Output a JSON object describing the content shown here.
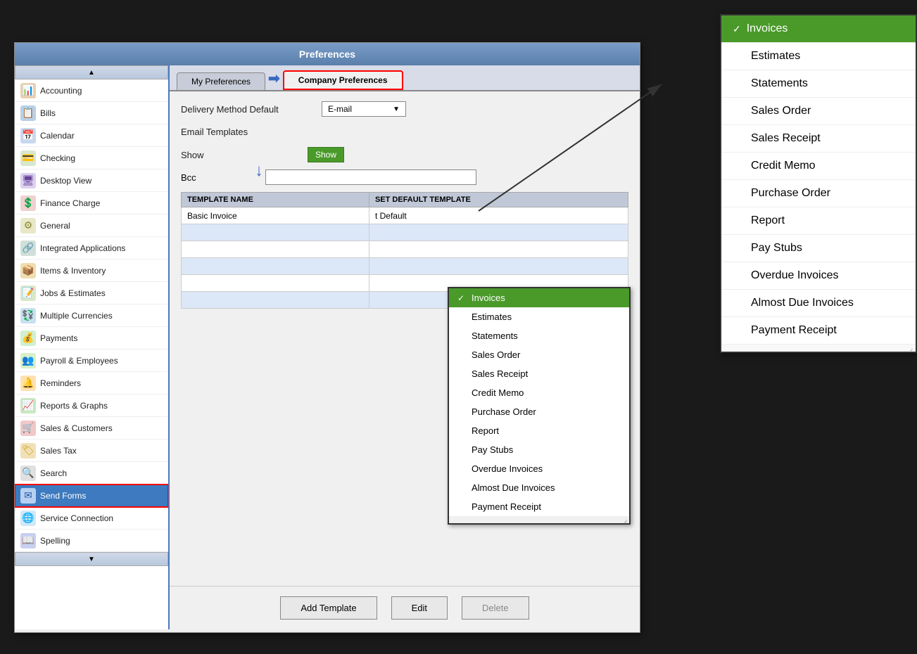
{
  "window": {
    "title": "Preferences"
  },
  "tabs": {
    "my_preferences": "My Preferences",
    "company_preferences": "Company Preferences"
  },
  "fields": {
    "delivery_method_label": "Delivery Method Default",
    "delivery_method_value": "E-mail",
    "email_templates_label": "Email Templates",
    "show_label": "Show",
    "bcc_label": "Bcc"
  },
  "table": {
    "col1": "TEMPLATE NAME",
    "col2": "SET DEFAULT TEMPLATE",
    "rows": [
      {
        "name": "Basic Invoice",
        "default": "t Default"
      },
      {
        "name": "",
        "default": ""
      },
      {
        "name": "",
        "default": ""
      },
      {
        "name": "",
        "default": ""
      },
      {
        "name": "",
        "default": ""
      },
      {
        "name": "",
        "default": ""
      },
      {
        "name": "",
        "default": ""
      }
    ]
  },
  "buttons": {
    "add_template": "Add Template",
    "edit": "Edit",
    "delete": "Delete"
  },
  "sidebar_items": [
    {
      "label": "Accounting",
      "icon": "📊"
    },
    {
      "label": "Bills",
      "icon": "📋"
    },
    {
      "label": "Calendar",
      "icon": "📅"
    },
    {
      "label": "Checking",
      "icon": "💳"
    },
    {
      "label": "Desktop View",
      "icon": "🖥"
    },
    {
      "label": "Finance Charge",
      "icon": "💲"
    },
    {
      "label": "General",
      "icon": "⚙"
    },
    {
      "label": "Integrated Applications",
      "icon": "🔗"
    },
    {
      "label": "Items & Inventory",
      "icon": "📦"
    },
    {
      "label": "Jobs & Estimates",
      "icon": "📝"
    },
    {
      "label": "Multiple Currencies",
      "icon": "💱"
    },
    {
      "label": "Payments",
      "icon": "💰"
    },
    {
      "label": "Payroll & Employees",
      "icon": "👥"
    },
    {
      "label": "Reminders",
      "icon": "🔔"
    },
    {
      "label": "Reports & Graphs",
      "icon": "📈"
    },
    {
      "label": "Sales & Customers",
      "icon": "🛒"
    },
    {
      "label": "Sales Tax",
      "icon": "🏷"
    },
    {
      "label": "Search",
      "icon": "🔍"
    },
    {
      "label": "Send Forms",
      "icon": "✉",
      "active": true
    },
    {
      "label": "Service Connection",
      "icon": "🌐"
    },
    {
      "label": "Spelling",
      "icon": "📖"
    }
  ],
  "center_dropdown": {
    "items": [
      {
        "label": "Invoices",
        "selected": true
      },
      {
        "label": "Estimates"
      },
      {
        "label": "Statements"
      },
      {
        "label": "Sales Order"
      },
      {
        "label": "Sales Receipt"
      },
      {
        "label": "Credit Memo"
      },
      {
        "label": "Purchase Order"
      },
      {
        "label": "Report"
      },
      {
        "label": "Pay Stubs"
      },
      {
        "label": "Overdue Invoices"
      },
      {
        "label": "Almost Due Invoices"
      },
      {
        "label": "Payment Receipt"
      }
    ]
  },
  "right_dropdown": {
    "items": [
      {
        "label": "Invoices",
        "selected": true
      },
      {
        "label": "Estimates"
      },
      {
        "label": "Statements"
      },
      {
        "label": "Sales Order"
      },
      {
        "label": "Sales Receipt"
      },
      {
        "label": "Credit Memo"
      },
      {
        "label": "Purchase Order"
      },
      {
        "label": "Report"
      },
      {
        "label": "Pay Stubs"
      },
      {
        "label": "Overdue Invoices"
      },
      {
        "label": "Almost Due Invoices"
      },
      {
        "label": "Payment Receipt"
      }
    ]
  }
}
